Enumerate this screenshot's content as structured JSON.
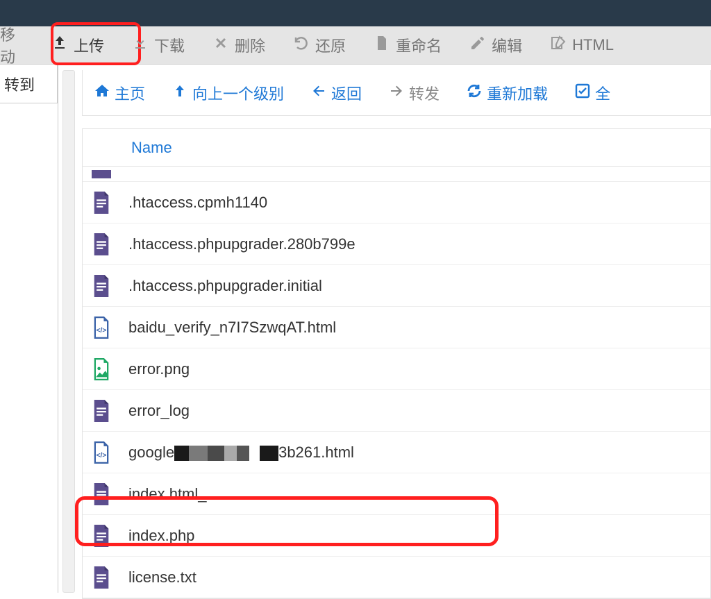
{
  "toolbar": {
    "move_partial": "移动",
    "upload": "上传",
    "download": "下载",
    "delete": "删除",
    "restore": "还原",
    "rename": "重命名",
    "edit": "编辑",
    "html_partial": "HTML"
  },
  "left": {
    "goto_partial": "转到"
  },
  "nav": {
    "home": "主页",
    "up_level": "向上一个级别",
    "back": "返回",
    "forward": "转发",
    "reload": "重新加载",
    "select_partial": "全"
  },
  "table": {
    "name_header": "Name",
    "rows": [
      {
        "name": "",
        "icon": "file-doc",
        "stub": true
      },
      {
        "name": ".htaccess.cpmh1140",
        "icon": "file-doc"
      },
      {
        "name": ".htaccess.phpupgrader.280b799e",
        "icon": "file-doc"
      },
      {
        "name": ".htaccess.phpupgrader.initial",
        "icon": "file-doc"
      },
      {
        "name": "baidu_verify_n7I7SzwqAT.html",
        "icon": "file-code"
      },
      {
        "name": "error.png",
        "icon": "file-image"
      },
      {
        "name": "error_log",
        "icon": "file-doc"
      },
      {
        "name_prefix": "google",
        "name_suffix": "3b261.html",
        "icon": "file-code",
        "redacted": true
      },
      {
        "name": "index.html_",
        "icon": "file-doc"
      },
      {
        "name": "index.php",
        "icon": "file-doc"
      },
      {
        "name": "license.txt",
        "icon": "file-doc"
      }
    ]
  },
  "colors": {
    "accent_blue": "#1e78d6",
    "highlight_red": "#ff1f1f",
    "icon_purple": "#5b4e8e",
    "icon_blue": "#3b63a8",
    "icon_green": "#1fa865"
  }
}
